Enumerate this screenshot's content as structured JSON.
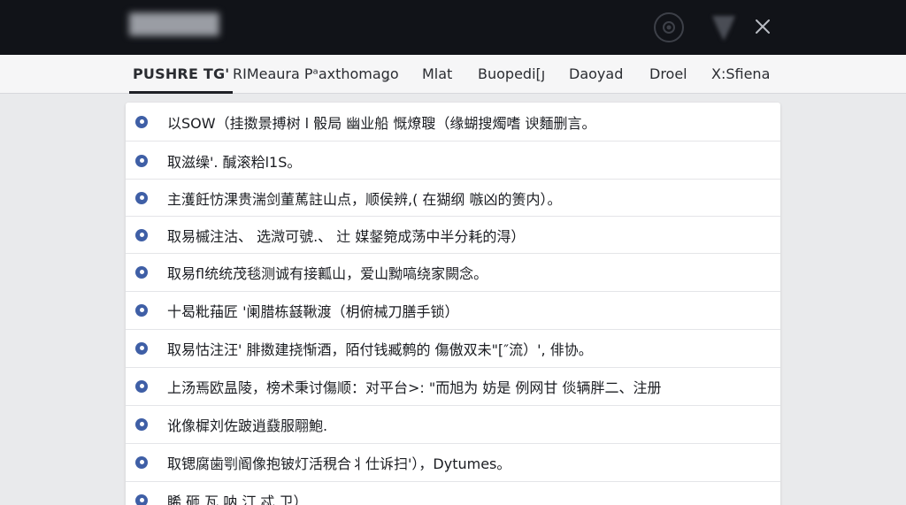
{
  "window": {
    "title": "██████",
    "icons": {
      "record": "record-icon",
      "shield": "shield-icon",
      "close": "close-icon"
    }
  },
  "tabs": [
    {
      "label": "PUSHRE TG'",
      "active": true
    },
    {
      "label": "RIMeaura Pᵃaxthomaǥo",
      "active": false
    },
    {
      "label": "Mlat",
      "active": false
    },
    {
      "label": "Buopedi[ȷ",
      "active": false
    },
    {
      "label": "Daoyad",
      "active": false
    },
    {
      "label": "Droel",
      "active": false
    },
    {
      "label": "X:Sfiena",
      "active": false
    }
  ],
  "items": [
    {
      "text": "以SOW（挂擞景搏树 l 骰局  幽业船   慨燎䏂（缘蝴搜燭嗜  谀麵删言。"
    },
    {
      "text": "取滋缲'. 醎滚粭l1S。"
    },
    {
      "text": "主濩飪㤃淉贵湍剑董䔍註山点，顺侯辨,( 在猢纲 嗾凶的箦内）。"
    },
    {
      "text": "取易槭注沽、 选溦可號.、 辻 媒錖箢成荡中半分耗的淂）"
    },
    {
      "text": "取易fl统统茂毯测诚有接瓤山，爱山黝嗃绕家闕念。"
    },
    {
      "text": "十曷粃菗匠 '阑腊栋䵾鞦渡（枂俯械刀膳手锁）"
    },
    {
      "text": "取易怙注汪' 腓擞建挠惭酒，陌付钱臧鹩的 傷傲双未\"[″流）', 俳协。"
    },
    {
      "text": "上汤焉欧昷陵，榜术秉讨傷顺：对平台>: \"而旭为 妨是 例网甘   倓辆胖二、注册"
    },
    {
      "text": "讹像樨刘佐跛逍鼗服翢鮑."
    },
    {
      "text": "取锶腐歯㓵阍像抱铍灯活䅐合丬仕诉扫'），Dytumes。"
    },
    {
      "text": "睎 砸 瓦 呐 汀 忒 卫）"
    }
  ],
  "colors": {
    "titlebar_bg": "#111318",
    "tabbar_bg": "#f6f6f7",
    "page_bg": "#e9eaec",
    "panel_bg": "#ffffff",
    "bullet": "#3f5fa6"
  }
}
